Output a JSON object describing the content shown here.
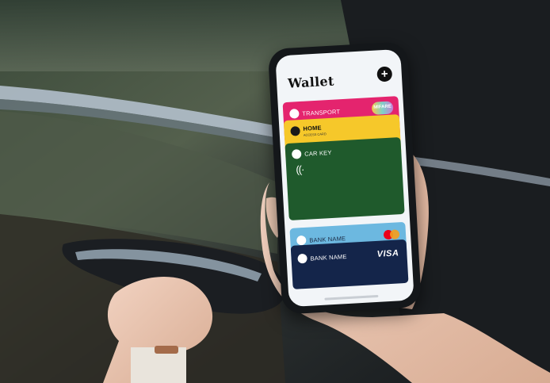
{
  "wallet": {
    "title": "Wallet",
    "add_label": "+"
  },
  "cards": {
    "transport": {
      "label": "TRANSPORT",
      "badge": "MIFARE",
      "color": "#e4246e"
    },
    "home": {
      "label": "HOME",
      "sublabel": "ACCESS CARD",
      "color": "#f6c82a"
    },
    "car_key": {
      "label": "CAR KEY",
      "nfc_symbol": "((·",
      "color": "#1f5a2c"
    },
    "bank_1": {
      "label": "BANK NAME",
      "network": "mastercard",
      "color": "#6cb8e0"
    },
    "bank_2": {
      "label": "BANK NAME",
      "network": "VISA",
      "color": "#14254a"
    }
  },
  "icons": [
    "add-icon",
    "train-icon",
    "house-icon",
    "car-icon",
    "contactless-icon",
    "bank-icon",
    "mastercard-logo",
    "visa-logo"
  ]
}
